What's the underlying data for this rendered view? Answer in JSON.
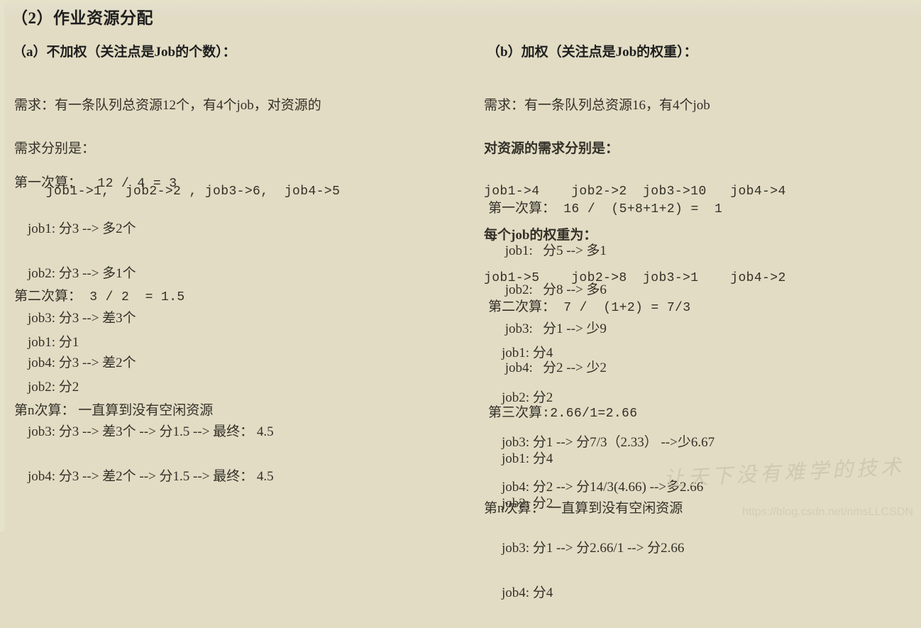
{
  "document": {
    "title": "（2）作业资源分配"
  },
  "watermark": {
    "brush_text": "让天下没有难学的技术",
    "url": "https://blog.csdn.net/nmsLLCSDN"
  },
  "left_column": {
    "section_title": "（a）不加权（关注点是Job的个数）：",
    "requirement": {
      "line1": "需求：有一条队列总资源12个，有4个job，对资源的",
      "line2": "需求分别是：",
      "line3": "    job1->1,  job2->2 , job3->6,  job4->5"
    },
    "round1": {
      "header_cn": "第一次算：",
      "header_expr": "  12 / 4 = 3",
      "rows": [
        "    job1: 分3 --> 多2个",
        "    job2: 分3 --> 多1个",
        "    job3: 分3 --> 差3个",
        "    job4: 分3 --> 差2个"
      ]
    },
    "round2": {
      "header_cn": "第二次算：",
      "header_expr": " 3 / 2  = 1.5",
      "rows": [
        "    job1: 分1",
        "    job2: 分2",
        "    job3: 分3 --> 差3个 --> 分1.5 --> 最终： 4.5",
        "    job4: 分3 --> 差2个 --> 分1.5 --> 最终： 4.5"
      ]
    },
    "round_n": "第n次算： 一直算到没有空闲资源"
  },
  "right_column": {
    "section_title": "（b）加权（关注点是Job的权重）：",
    "requirement": {
      "line1": "需求：有一条队列总资源16，有4个job",
      "demand_label": "对资源的需求分别是：",
      "demand_values": "job1->4    job2->2  job3->10   job4->4",
      "weight_label": "每个job的权重为：",
      "weight_values": "job1->5    job2->8  job3->1    job4->2"
    },
    "round1": {
      "header_cn": "第一次算：",
      "header_expr": " 16 /  (5+8+1+2) =  1",
      "rows": [
        "     job1:   分5 --> 多1",
        "     job2:   分8 --> 多6",
        "     job3:   分1 --> 少9",
        "     job4:   分2 --> 少2"
      ]
    },
    "round2": {
      "header_cn": "第二次算：",
      "header_expr": " 7 /  (1+2) = 7/3",
      "rows": [
        "    job1: 分4",
        "    job2: 分2",
        "    job3: 分1 --> 分7/3（2.33） -->少6.67",
        "    job4: 分2 --> 分14/3(4.66) -->多2.66"
      ]
    },
    "round3": {
      "header_cn": "第三次算",
      "header_expr": ":2.66/1=2.66",
      "rows": [
        "    job1: 分4",
        "    job2: 分2",
        "    job3: 分1 --> 分2.66/1 --> 分2.66",
        "    job4: 分4"
      ]
    },
    "round_n": "第n次算： 一直算到没有空闲资源"
  }
}
